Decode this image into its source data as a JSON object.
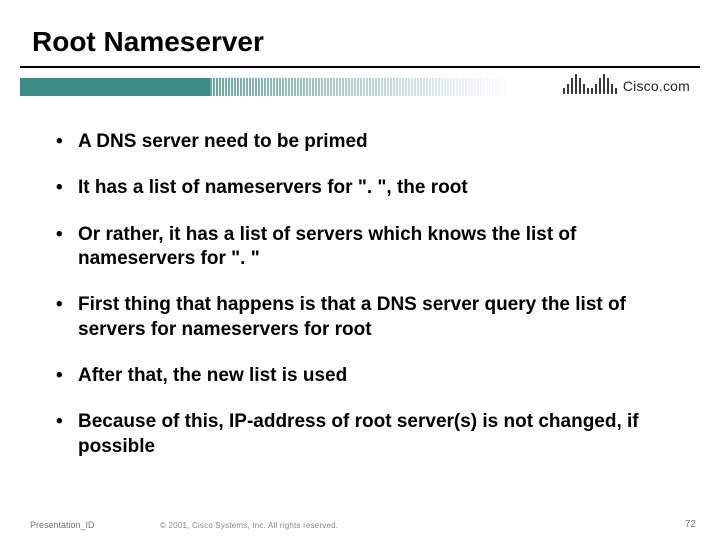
{
  "title": "Root Nameserver",
  "logo_text": "Cisco.com",
  "bullets": [
    "A DNS server need to be primed",
    "It has a list of nameservers for \". \", the root",
    "Or rather, it has a list of servers which knows the list of nameservers for \". \"",
    "First thing that happens is that a DNS server query the list of servers for nameservers for root",
    "After that, the new list is used",
    "Because of this, IP-address of root server(s) is not changed,  if possible"
  ],
  "footer": {
    "presentation_id": "Presentation_ID",
    "copyright": "© 2001, Cisco Systems, Inc. All rights reserved.",
    "page_number": "72"
  },
  "logo_bar_heights": [
    6,
    10,
    16,
    20,
    16,
    10,
    6,
    6,
    10,
    16,
    20,
    16,
    10,
    6
  ]
}
